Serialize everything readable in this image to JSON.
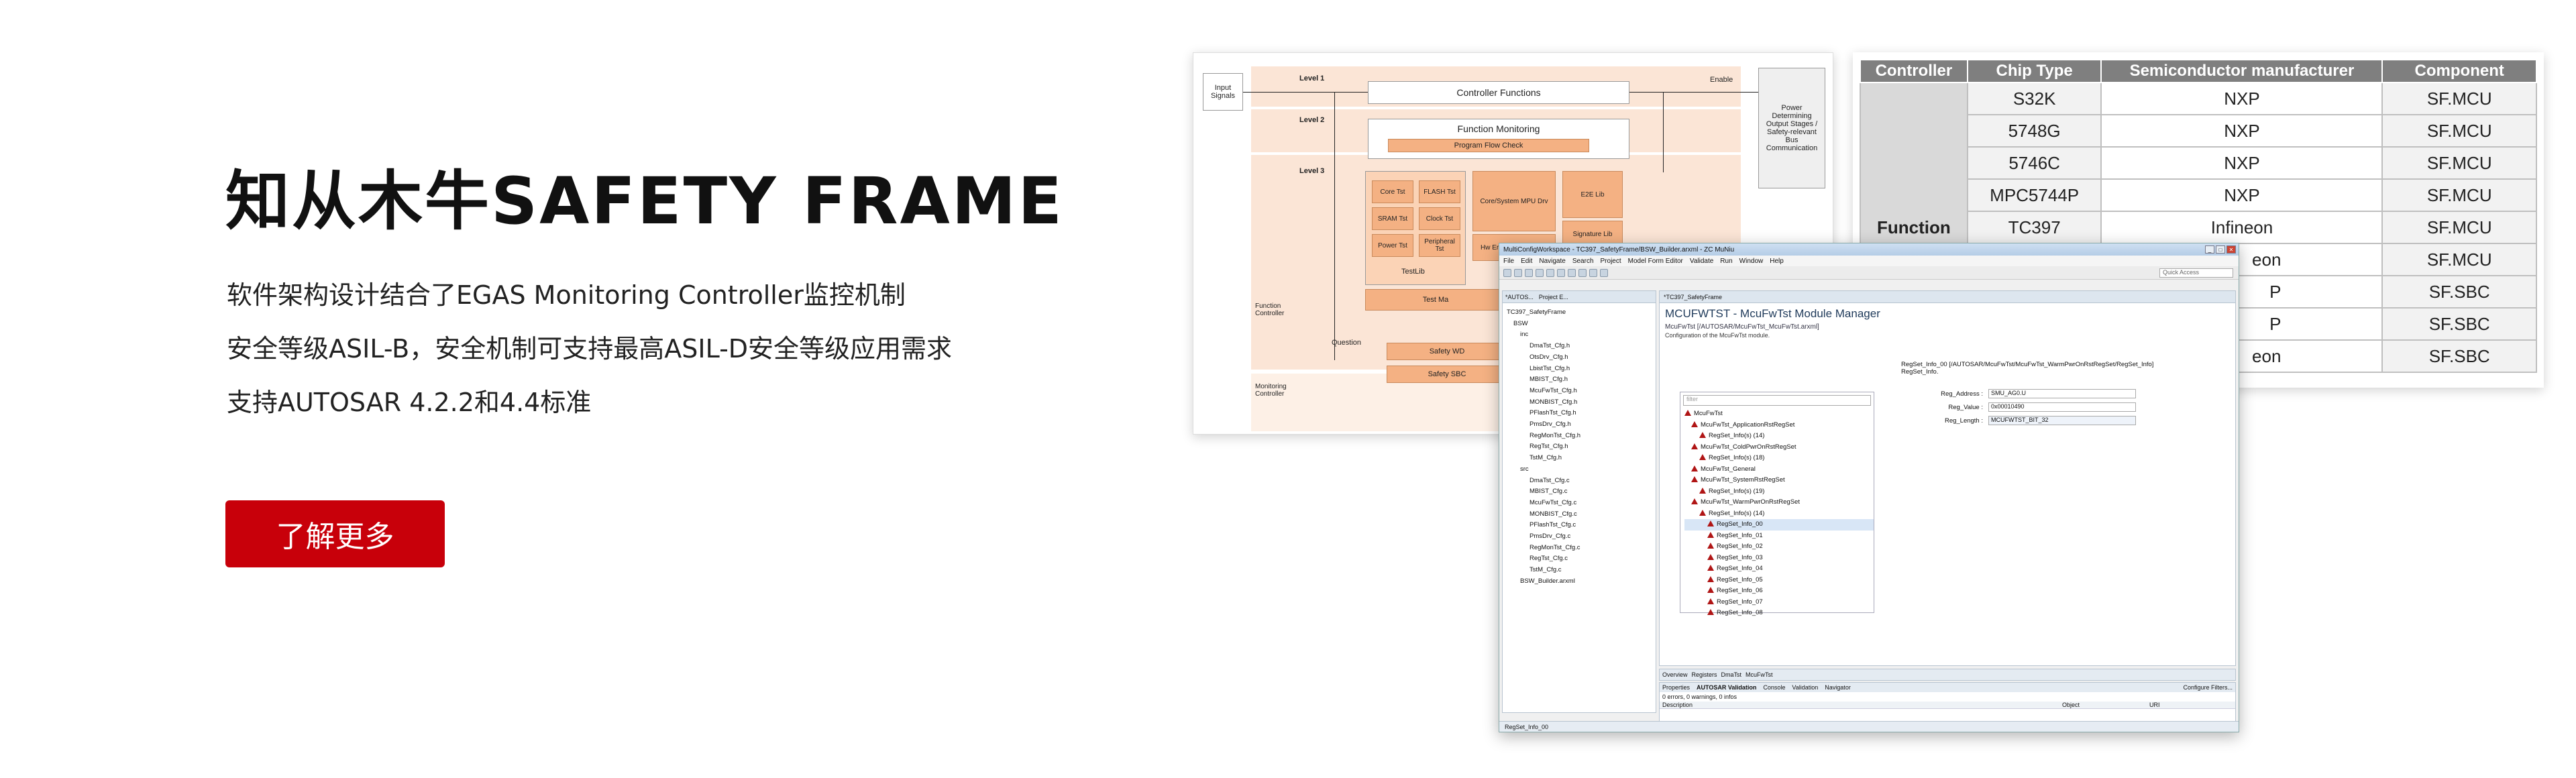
{
  "hero": {
    "title": "知从木牛SAFETY FRAME",
    "lines": [
      "软件架构设计结合了EGAS Monitoring Controller监控机制",
      "安全等级ASIL-B，安全机制可支持最高ASIL-D安全等级应用需求",
      "支持AUTOSAR 4.2.2和4.4标准"
    ],
    "cta_label": "了解更多"
  },
  "diagram": {
    "input_signals": "Input\nSignals",
    "level1": "Level 1",
    "level2": "Level 2",
    "level3": "Level 3",
    "controller_functions": "Controller Functions",
    "function_monitoring": "Function Monitoring",
    "program_flow_check": "Program Flow Check",
    "enable": "Enable",
    "power_output": "Power Determining Output Stages / Safety-relevant Bus Communication",
    "tests": [
      "Core Tst",
      "FLASH Tst",
      "SRAM Tst",
      "Clock Tst",
      "Power Tst",
      "Peripheral Tst"
    ],
    "testlib": "TestLib",
    "com_mpu": "Core/System MPU Drv",
    "hw_error": "Hw Error Manager Drv",
    "e2e": "E2E Lib",
    "signature": "Signature Lib",
    "test_mgr": "Test Ma",
    "function_controller": "Function\nController",
    "question": "Question",
    "safety_wd": "Safety WD",
    "safety_sbc": "Safety SBC",
    "monitoring_controller": "Monitoring\nController"
  },
  "table": {
    "headers": [
      "Controller",
      "Chip Type",
      "Semiconductor manufacturer",
      "Component"
    ],
    "row_group": "Function",
    "rows": [
      [
        "S32K",
        "NXP",
        "SF.MCU"
      ],
      [
        "5748G",
        "NXP",
        "SF.MCU"
      ],
      [
        "5746C",
        "NXP",
        "SF.MCU"
      ],
      [
        "MPC5744P",
        "NXP",
        "SF.MCU"
      ],
      [
        "TC397",
        "Infineon",
        "SF.MCU"
      ],
      [
        "",
        "eon",
        "SF.MCU"
      ],
      [
        "",
        "P",
        "SF.SBC"
      ],
      [
        "",
        "P",
        "SF.SBC"
      ],
      [
        "",
        "eon",
        "SF.SBC"
      ]
    ]
  },
  "ide": {
    "window_title": "MultiConfigWorkspace - TC397_SafetyFrame/BSW_Builder.arxml - ZC MuNiu",
    "menu": [
      "File",
      "Edit",
      "Navigate",
      "Search",
      "Project",
      "Model Form Editor",
      "Validate",
      "Run",
      "Window",
      "Help"
    ],
    "quick_access": "Quick Access",
    "left_tabs": [
      "*AUTOS...",
      "Project E..."
    ],
    "editor_tab": "*TC397_SafetyFrame",
    "project_tree": [
      "TC397_SafetyFrame",
      "BSW",
      "inc",
      "DmaTst_Cfg.h",
      "OtsDrv_Cfg.h",
      "LbistTst_Cfg.h",
      "MBIST_Cfg.h",
      "McuFwTst_Cfg.h",
      "MONBIST_Cfg.h",
      "PFlashTst_Cfg.h",
      "PmsDrv_Cfg.h",
      "RegMonTst_Cfg.h",
      "RegTst_Cfg.h",
      "TstM_Cfg.h",
      "src",
      "DmaTst_Cfg.c",
      "MBIST_Cfg.c",
      "McuFwTst_Cfg.c",
      "MONBIST_Cfg.c",
      "PFlashTst_Cfg.c",
      "PmsDrv_Cfg.c",
      "RegMonTst_Cfg.c",
      "RegTst_Cfg.c",
      "TstM_Cfg.c",
      "BSW_Builder.arxml"
    ],
    "module_title": "MCUFWTST - McuFwTst Module Manager",
    "module_path": "McuFwTst [/AUTOSAR/McuFwTst_McuFwTst.arxml]",
    "module_desc": "Configuration of the McuFwTst module.",
    "filter_placeholder": "filter",
    "config_tree": [
      "McuFwTst",
      "McuFwTst_ApplicationRstRegSet",
      "RegSet_Info(s) (14)",
      "McuFwTst_ColdPwrOnRstRegSet",
      "RegSet_Info(s) (18)",
      "McuFwTst_General",
      "McuFwTst_SystemRstRegSet",
      "RegSet_Info(s) (19)",
      "McuFwTst_WarmPwrOnRstRegSet",
      "RegSet_Info(s) (14)",
      "RegSet_Info_00",
      "RegSet_Info_01",
      "RegSet_Info_02",
      "RegSet_Info_03",
      "RegSet_Info_04",
      "RegSet_Info_05",
      "RegSet_Info_06",
      "RegSet_Info_07",
      "RegSet_Info_08"
    ],
    "detail_title": "RegSet_Info_00 [/AUTOSAR/McuFwTst/McuFwTst_WarmPwrOnRstRegSet/RegSet_Info]",
    "detail_sub": "RegSet_Info.",
    "reg_address_label": "Reg_Address :",
    "reg_address_value": "SMU_AG0.U",
    "reg_value_label": "Reg_Value :",
    "reg_value_value": "0x00010490",
    "reg_length_label": "Reg_Length :",
    "reg_length_value": "MCUFWTST_BIT_32",
    "bottom_tabs": [
      "Overview",
      "Registers",
      "DmaTst",
      "McuFwTst"
    ],
    "console_tabs": [
      "Properties",
      "AUTOSAR Validation",
      "Console",
      "Validation",
      "Navigator"
    ],
    "configure_filters": "Configure Filters...",
    "problems_summary": "0 errors, 0 warnings, 0 infos",
    "problems_headers": [
      "Description",
      "Object",
      "URI"
    ],
    "status_text": "RegSet_Info_00"
  }
}
